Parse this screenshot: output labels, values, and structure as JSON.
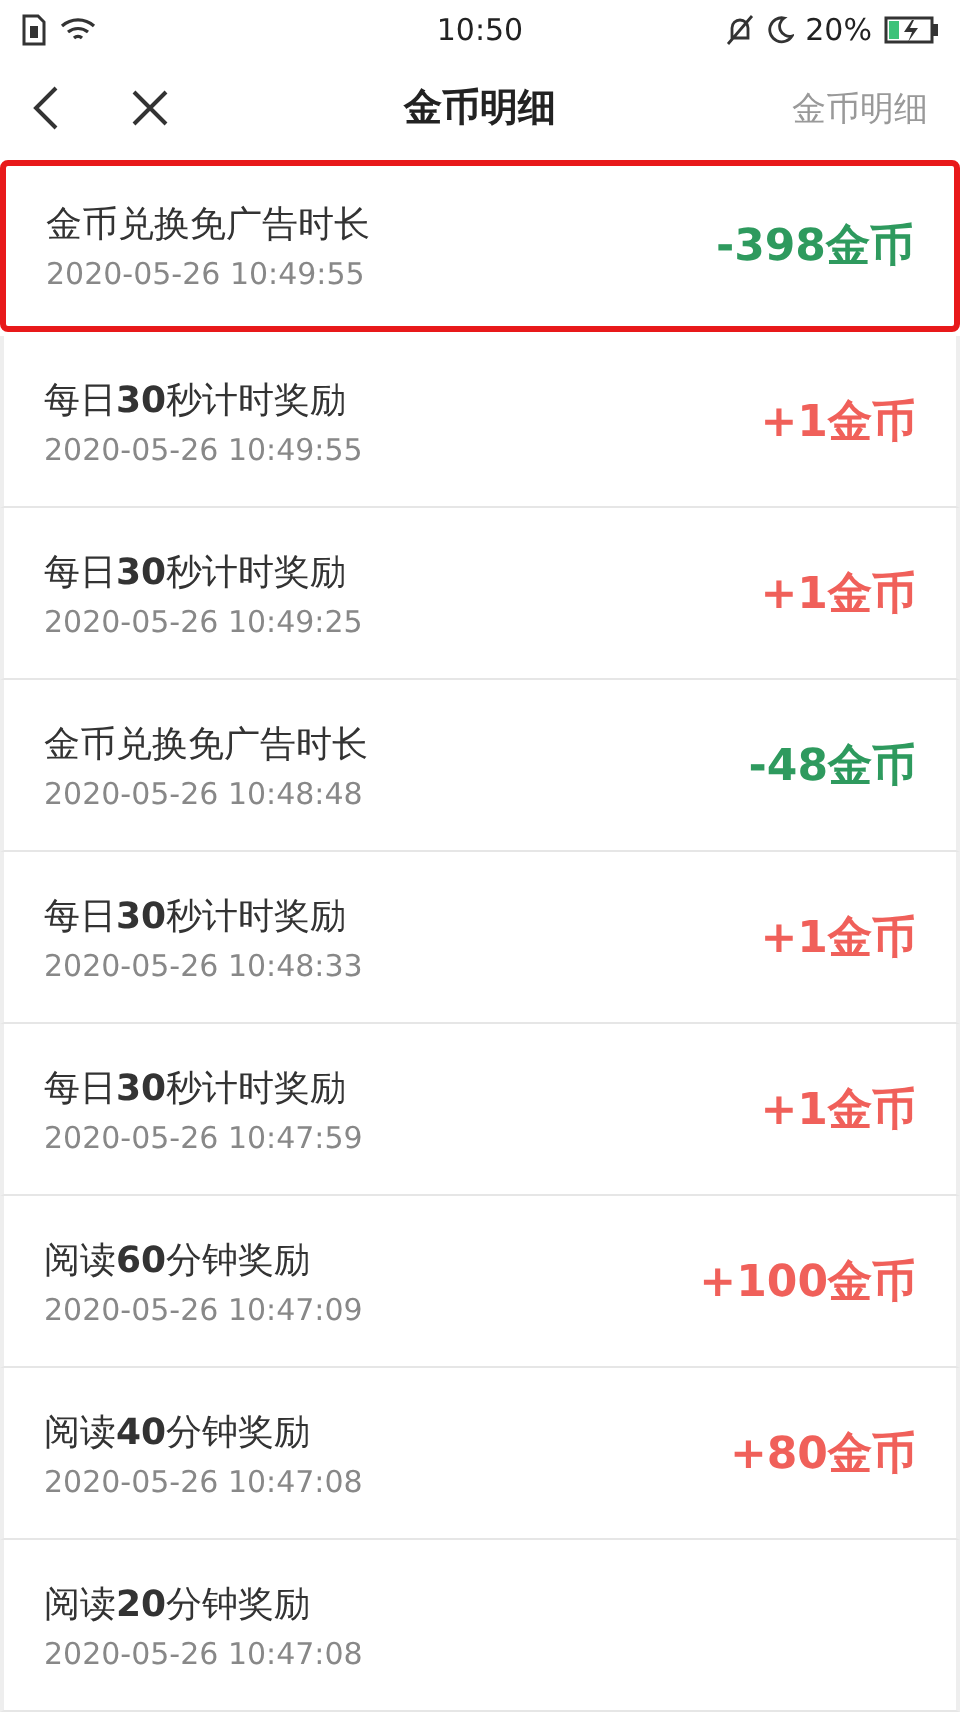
{
  "status_bar": {
    "time": "10:50",
    "battery": "20%"
  },
  "nav": {
    "title": "金币明细",
    "action": "金币明细"
  },
  "records": [
    {
      "title": "金币兑换免广告时长",
      "time": "2020-05-26 10:49:55",
      "amount": "-398金币",
      "kind": "spend",
      "highlighted": true
    },
    {
      "title": "每日**30**秒计时奖励",
      "time": "2020-05-26 10:49:55",
      "amount": "+1金币",
      "kind": "earn",
      "highlighted": false
    },
    {
      "title": "每日**30**秒计时奖励",
      "time": "2020-05-26 10:49:25",
      "amount": "+1金币",
      "kind": "earn",
      "highlighted": false
    },
    {
      "title": "金币兑换免广告时长",
      "time": "2020-05-26 10:48:48",
      "amount": "-48金币",
      "kind": "spend",
      "highlighted": false
    },
    {
      "title": "每日**30**秒计时奖励",
      "time": "2020-05-26 10:48:33",
      "amount": "+1金币",
      "kind": "earn",
      "highlighted": false
    },
    {
      "title": "每日**30**秒计时奖励",
      "time": "2020-05-26 10:47:59",
      "amount": "+1金币",
      "kind": "earn",
      "highlighted": false
    },
    {
      "title": "阅读**60**分钟奖励",
      "time": "2020-05-26 10:47:09",
      "amount": "+100金币",
      "kind": "earn",
      "highlighted": false
    },
    {
      "title": "阅读**40**分钟奖励",
      "time": "2020-05-26 10:47:08",
      "amount": "+80金币",
      "kind": "earn",
      "highlighted": false
    },
    {
      "title": "阅读**20**分钟奖励",
      "time": "2020-05-26 10:47:08",
      "highlighted": false
    }
  ]
}
